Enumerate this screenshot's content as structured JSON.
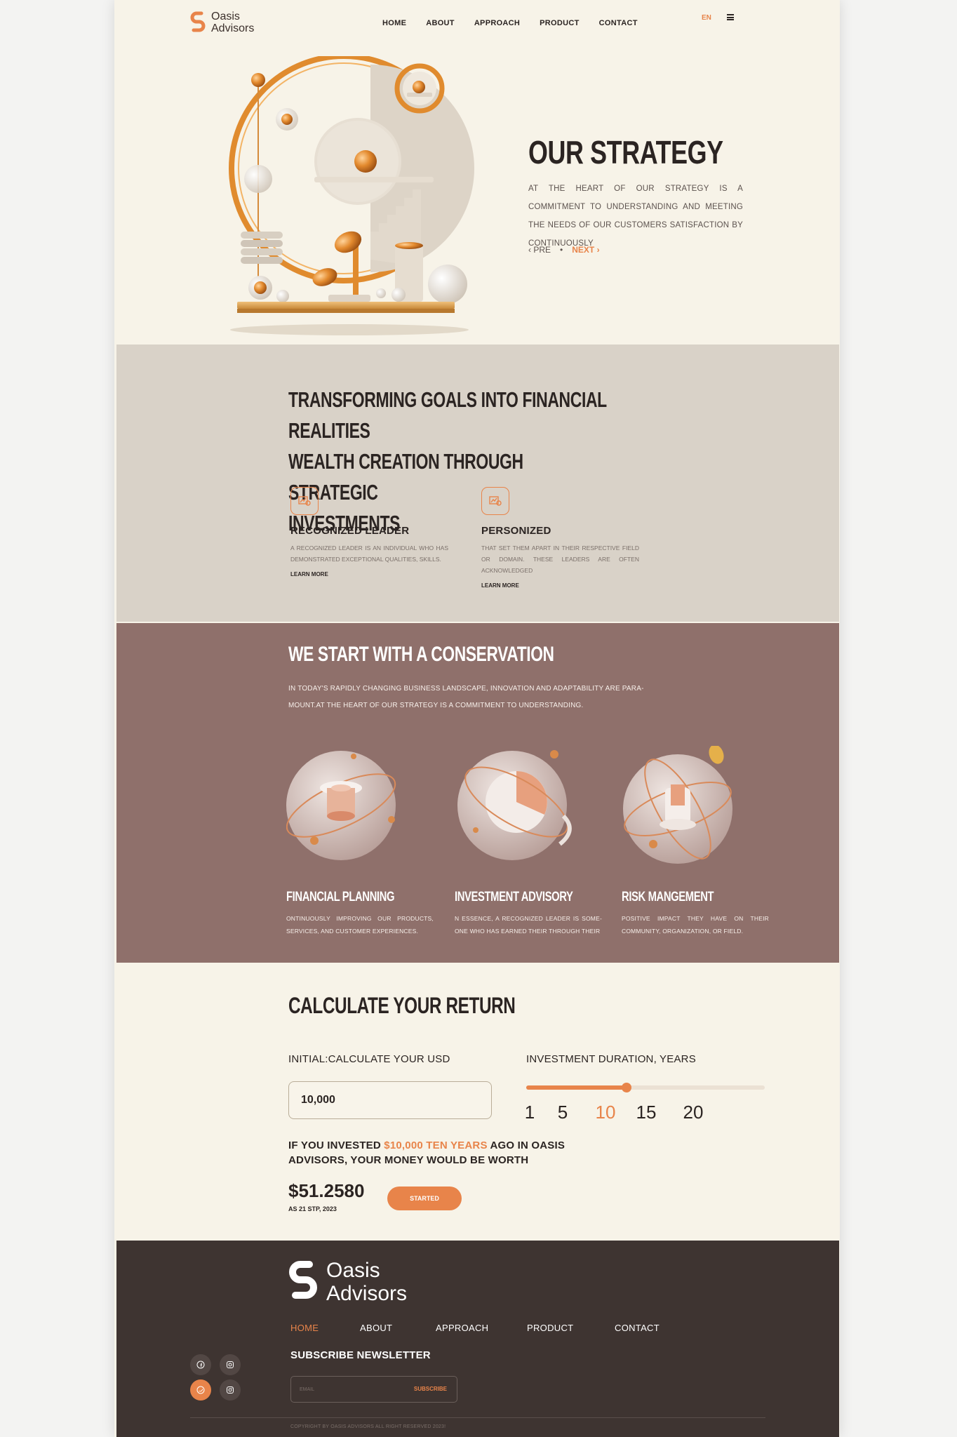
{
  "brand": {
    "name_line1": "Oasis",
    "name_line2": "Advisors",
    "accent": "#e8844a"
  },
  "nav": {
    "items": [
      "HOME",
      "ABOUT",
      "APPROACH",
      "PRODUCT",
      "CONTACT"
    ],
    "lang": "EN",
    "menu_icon": "hamburger-icon"
  },
  "hero": {
    "title": "OUR STRATEGY",
    "text": "AT THE HEART OF OUR STRATEGY IS A COMMITMENT TO UNDERSTANDING AND MEETING THE NEEDS OF OUR CUSTOMERS SATISFACTION BY CONTINUOUSLY",
    "pre": "PRE",
    "next": "NEXT"
  },
  "goals": {
    "title_line1": "TRANSFORMING GOALS INTO FINANCIAL REALITIES",
    "title_line2": "WEALTH CREATION THROUGH STRATEGIC",
    "title_line3": "INVESTMENTS",
    "features": [
      {
        "icon": "chart-icon",
        "title": "RECOGNIZED LEADER",
        "text": "A RECOGNIZED LEADER IS AN INDIVIDUAL WHO HAS DEMONSTRATED EXCEPTIONAL QUALITIES, SKILLS.",
        "link": "LEARN MORE"
      },
      {
        "icon": "chart-icon",
        "title": "PERSONIZED",
        "text": "THAT SET THEM APART IN THEIR RESPECTIVE FIELD OR DOMAIN. THESE LEADERS ARE OFTEN ACKNOWLEDGED",
        "link": "LEARN MORE"
      }
    ]
  },
  "conversation": {
    "title": "WE START WITH A CONSERVATION",
    "text": "IN TODAY'S RAPIDLY CHANGING BUSINESS LANDSCAPE, INNOVATION AND ADAPTABILITY ARE PARA-MOUNT.AT THE HEART OF OUR STRATEGY IS A COMMITMENT TO UNDERSTANDING.",
    "services": [
      {
        "title": "FINANCIAL PLANNING",
        "text": "ONTINUOUSLY IMPROVING OUR PRODUCTS, SERVICES, AND CUSTOMER EXPERIENCES."
      },
      {
        "title": "INVESTMENT ADVISORY",
        "text": "N ESSENCE, A RECOGNIZED LEADER IS SOME-ONE WHO HAS EARNED THEIR THROUGH THEIR"
      },
      {
        "title": "RISK MANGEMENT",
        "text": "POSITIVE IMPACT THEY HAVE ON THEIR COMMUNITY, ORGANIZATION, OR FIELD."
      }
    ]
  },
  "calculator": {
    "title": "CALCULATE YOUR RETURN",
    "initial_label": "INITIAL:CALCULATE YOUR USD",
    "initial_value": "10,000",
    "duration_label": "INVESTMENT DURATION, YEARS",
    "duration_options": [
      "1",
      "5",
      "10",
      "15",
      "20"
    ],
    "duration_selected": "10",
    "slider_fraction": 0.42,
    "result_prefix": "IF YOU INVESTED ",
    "result_highlight": "$10,000 TEN YEARS",
    "result_suffix": " AGO IN OASIS ADVISORS, YOUR MONEY WOULD BE WORTH",
    "worth": "$51.2580",
    "as_of": "AS 21 STP, 2023",
    "cta": "STARTED"
  },
  "footer": {
    "nav": [
      "HOME",
      "ABOUT",
      "APPROACH",
      "PRODUCT",
      "CONTACT"
    ],
    "newsletter_title": "SUBSCRIBE NEWSLETTER",
    "email_placeholder": "EMAIL",
    "subscribe": "SUBSCRIBE",
    "social": [
      "facebook-icon",
      "instagram-icon",
      "twitter-icon",
      "instagram-icon"
    ],
    "copyright": "COPYRIGHT BY OASIS ADVISORS ALL RIGHT RESERVED 2023!"
  }
}
